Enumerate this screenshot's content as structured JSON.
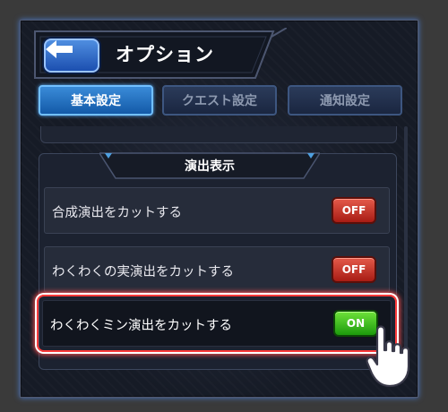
{
  "header": {
    "title": "オプション",
    "back_icon": "back-arrow-icon"
  },
  "tabs": [
    {
      "label": "基本設定",
      "active": true
    },
    {
      "label": "クエスト設定",
      "active": false
    },
    {
      "label": "通知設定",
      "active": false
    }
  ],
  "section": {
    "title": "演出表示",
    "settings": [
      {
        "label": "合成演出をカットする",
        "state": "OFF"
      },
      {
        "label": "わくわくの実演出をカットする",
        "state": "OFF"
      },
      {
        "label": "わくわくミン演出をカットする",
        "state": "ON",
        "highlighted": true
      }
    ]
  },
  "colors": {
    "on": "#2cb81a",
    "off": "#c8301f",
    "highlight": "#ff3a3a",
    "active_tab": "#1e6fc4"
  },
  "pointer_icon": "hand-pointer-icon"
}
